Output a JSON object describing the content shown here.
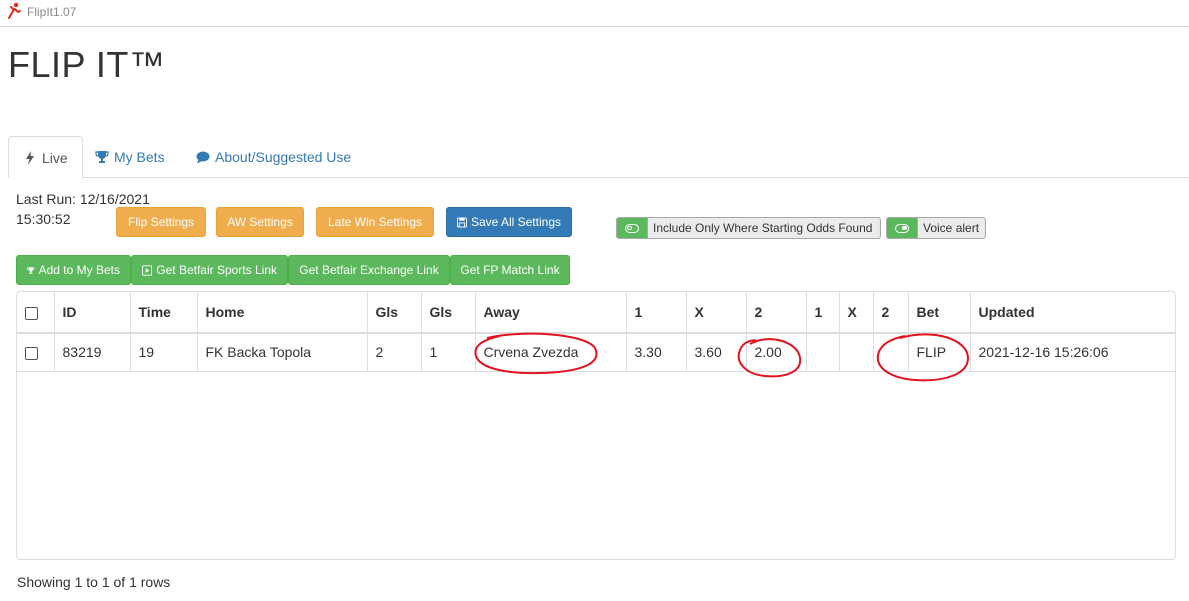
{
  "window": {
    "title": "FlipIt1.07",
    "icon": "app-logo-icon"
  },
  "brand": {
    "title": "FLIP IT™"
  },
  "tabs": [
    {
      "label": "Live",
      "icon": "bolt-icon",
      "active": true
    },
    {
      "label": "My Bets",
      "icon": "trophy-icon",
      "active": false
    },
    {
      "label": "About/Suggested Use",
      "icon": "comment-icon",
      "active": false
    }
  ],
  "status": {
    "last_run_line1": "Last Run: 12/16/2021",
    "last_run_line2": "15:30:52"
  },
  "settings_buttons": {
    "flip": "Flip Settings",
    "aw": "AW Settings",
    "late_win": "Late Win Settings",
    "save_all": "Save All Settings"
  },
  "toggles": {
    "starting_odds": "Include Only Where Starting Odds Found",
    "voice_alert": "Voice alert"
  },
  "action_buttons": {
    "add_to_bets": "Add to My Bets",
    "sports_link": "Get Betfair Sports Link",
    "exchange_link": "Get Betfair Exchange Link",
    "match_link": "Get FP Match Link"
  },
  "table": {
    "headers": [
      "ID",
      "Time",
      "Home",
      "Gls",
      "Gls",
      "Away",
      "1",
      "X",
      "2",
      "1",
      "X",
      "2",
      "Bet",
      "Updated"
    ],
    "rows": [
      [
        "83219",
        "19",
        "FK Backa Topola",
        "2",
        "1",
        "Crvena Zvezda",
        "3.30",
        "3.60",
        "2.00",
        "",
        "",
        "",
        "FLIP",
        "2021-12-16 15:26:06"
      ]
    ]
  },
  "footer": {
    "pagination_text": "Showing 1 to 1 of 1 rows"
  },
  "colors": {
    "warning": "#f0ad4e",
    "primary": "#337ab7",
    "success": "#5cb85c",
    "annotation_red": "#e0141e"
  }
}
